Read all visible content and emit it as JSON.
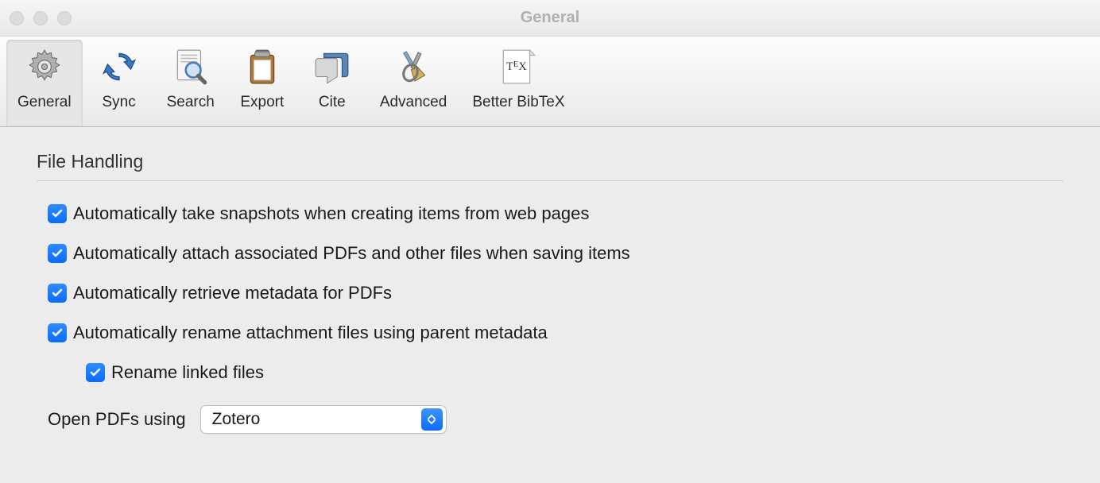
{
  "window": {
    "title": "General"
  },
  "toolbar": {
    "items": [
      {
        "label": "General",
        "icon": "gear-icon",
        "selected": true
      },
      {
        "label": "Sync",
        "icon": "sync-icon",
        "selected": false
      },
      {
        "label": "Search",
        "icon": "search-icon",
        "selected": false
      },
      {
        "label": "Export",
        "icon": "export-icon",
        "selected": false
      },
      {
        "label": "Cite",
        "icon": "cite-icon",
        "selected": false
      },
      {
        "label": "Advanced",
        "icon": "advanced-icon",
        "selected": false
      },
      {
        "label": "Better BibTeX",
        "icon": "bibtex-icon",
        "selected": false
      }
    ]
  },
  "section": {
    "title": "File Handling",
    "checkboxes": [
      {
        "label": "Automatically take snapshots when creating items from web pages",
        "checked": true,
        "indented": false
      },
      {
        "label": "Automatically attach associated PDFs and other files when saving items",
        "checked": true,
        "indented": false
      },
      {
        "label": "Automatically retrieve metadata for PDFs",
        "checked": true,
        "indented": false
      },
      {
        "label": "Automatically rename attachment files using parent metadata",
        "checked": true,
        "indented": false
      },
      {
        "label": "Rename linked files",
        "checked": true,
        "indented": true
      }
    ],
    "selectLabel": "Open PDFs using",
    "selectValue": "Zotero"
  }
}
